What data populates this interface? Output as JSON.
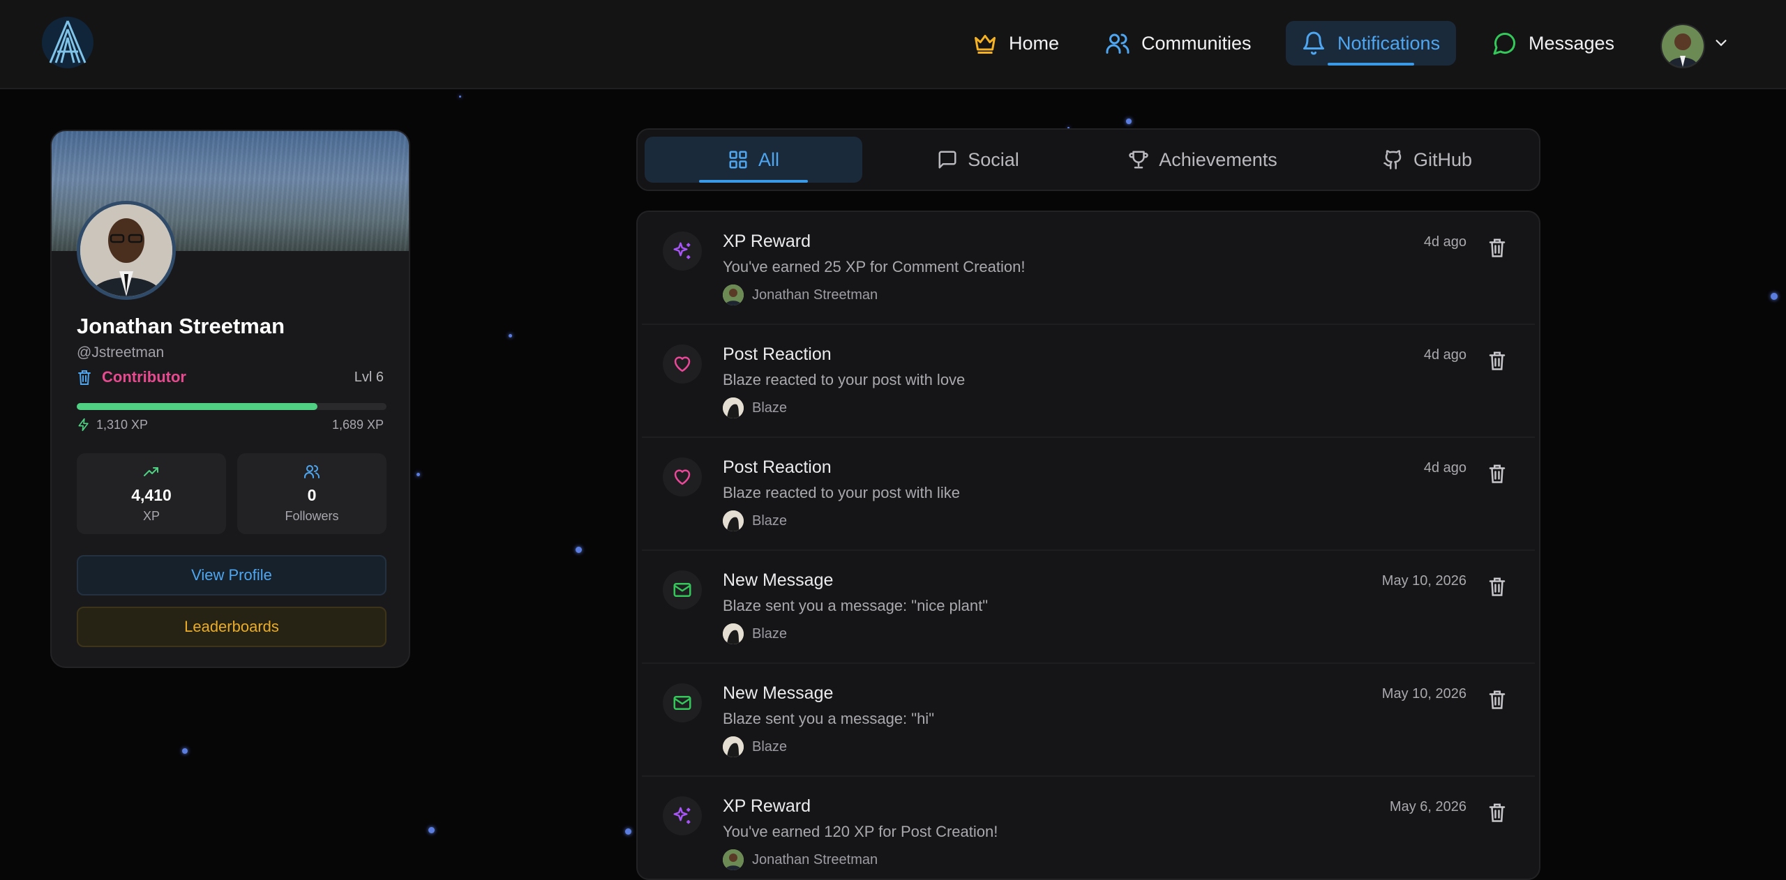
{
  "nav": {
    "items": [
      {
        "label": "Home",
        "icon": "crown-icon"
      },
      {
        "label": "Communities",
        "icon": "users-icon"
      },
      {
        "label": "Notifications",
        "icon": "bell-icon"
      },
      {
        "label": "Messages",
        "icon": "message-circle-icon"
      }
    ],
    "active": "Notifications"
  },
  "profile": {
    "name": "Jonathan Streetman",
    "handle": "@Jstreetman",
    "role": "Contributor",
    "level": "Lvl 6",
    "xp_current": "1,310 XP",
    "xp_next": "1,689 XP",
    "xp_progress": 0.776,
    "stats": [
      {
        "value": "4,410",
        "label": "XP"
      },
      {
        "value": "0",
        "label": "Followers"
      }
    ],
    "view_profile_label": "View Profile",
    "leaderboards_label": "Leaderboards"
  },
  "tabs": [
    {
      "label": "All",
      "icon": "grid-icon",
      "active": true
    },
    {
      "label": "Social",
      "icon": "chat-icon"
    },
    {
      "label": "Achievements",
      "icon": "trophy-icon"
    },
    {
      "label": "GitHub",
      "icon": "github-icon"
    }
  ],
  "notifications": [
    {
      "type": "xp",
      "title": "XP Reward",
      "text": "You've earned 25 XP for Comment Creation!",
      "user": "Jonathan Streetman",
      "time": "4d ago"
    },
    {
      "type": "reaction",
      "title": "Post Reaction",
      "text": "Blaze reacted to your post with love",
      "user": "Blaze",
      "time": "4d ago"
    },
    {
      "type": "reaction",
      "title": "Post Reaction",
      "text": "Blaze reacted to your post with like",
      "user": "Blaze",
      "time": "4d ago"
    },
    {
      "type": "message",
      "title": "New Message",
      "text": "Blaze sent you a message: \"nice plant\"",
      "user": "Blaze",
      "time": "May 10, 2026"
    },
    {
      "type": "message",
      "title": "New Message",
      "text": "Blaze sent you a message: \"hi\"",
      "user": "Blaze",
      "time": "May 10, 2026"
    },
    {
      "type": "xp",
      "title": "XP Reward",
      "text": "You've earned 120 XP for Post Creation!",
      "user": "Jonathan Streetman",
      "time": "May 6, 2026"
    }
  ],
  "colors": {
    "accent": "#4ea6f0",
    "xp_icon": "#a855f7",
    "reaction_icon": "#ec4899",
    "message_icon": "#34c759",
    "contributor": "#e64b8f",
    "xp_bar": "#4fd083",
    "leaderboards": "#e9ad2a"
  }
}
